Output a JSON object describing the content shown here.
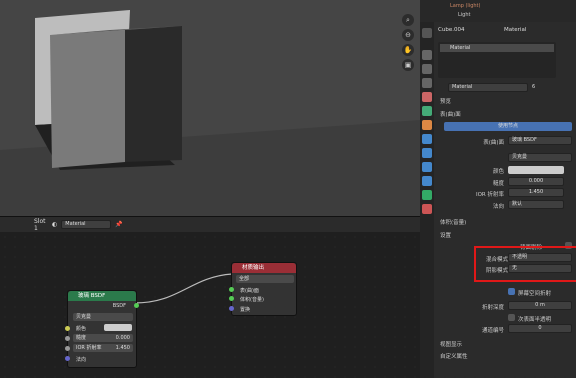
{
  "outliner": {
    "item1": "Lamp (light)",
    "item2": "Light"
  },
  "props_header": {
    "object": "Cube.004",
    "tab": "Material"
  },
  "slots": {
    "active": "Material"
  },
  "material": {
    "name": "Material",
    "users": "6"
  },
  "sections": {
    "preview": "预览",
    "surface": "表(曲)面",
    "volume": "体积(音量)",
    "settings": "设置",
    "viewport_display": "视图显示",
    "custom_props": "自定义属性"
  },
  "surface": {
    "use_nodes": "使用节点",
    "surface_label": "表(曲)面",
    "surface_value": "玻璃 BSDF",
    "distribution": "贝克曼",
    "color_label": "颜色",
    "roughness_label": "糙度",
    "roughness": "0.000",
    "ior_label": "IOR 折射率",
    "ior": "1.450",
    "normal_label": "法向",
    "normal_value": "默认"
  },
  "settings": {
    "backface_label": "背面剔除",
    "blend_label": "混合模式",
    "blend_value": "不透明",
    "shadow_label": "阴影模式",
    "shadow_value": "无",
    "ssr_label": "屏幕空间折射",
    "refr_depth_label": "折射深度",
    "refr_depth": "0 m",
    "sss_label": "次表面半透明",
    "pass_label": "通道编号",
    "pass": "0"
  },
  "node_header": {
    "slot": "Slot 1",
    "material": "Material"
  },
  "glass_node": {
    "title": "玻璃 BSDF",
    "out": "BSDF",
    "dist": "贝克曼",
    "color": "颜色",
    "rough": "糙度",
    "rough_val": "0.000",
    "ior": "IOR 折射率",
    "ior_val": "1.450",
    "normal": "法向"
  },
  "output_node": {
    "title": "材质输出",
    "target": "全部",
    "surface": "表(曲)面",
    "volume": "体积(音量)",
    "disp": "置换"
  },
  "colors": {
    "glass_header": "#2b7a4b",
    "output_header": "#9a2e36",
    "highlight": "#e01818",
    "accent": "#4772b3"
  }
}
